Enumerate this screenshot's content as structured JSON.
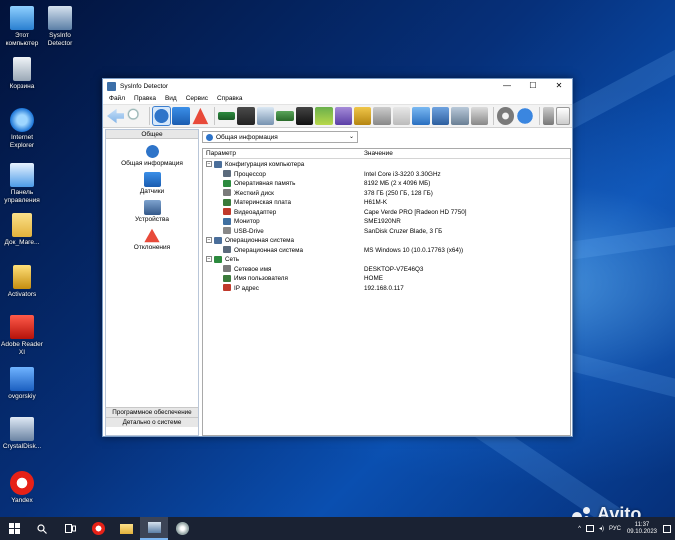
{
  "desktop": {
    "icons": [
      {
        "label": "Этот компьютер"
      },
      {
        "label": "SysInfo Detector"
      },
      {
        "label": "Корзина"
      },
      {
        "label": "Internet Explorer"
      },
      {
        "label": "Панель управления"
      },
      {
        "label": "Док_Маге..."
      },
      {
        "label": "Activators"
      },
      {
        "label": "Adobe Reader XI"
      },
      {
        "label": "ovgorskiy"
      },
      {
        "label": "CrystalDisk..."
      },
      {
        "label": "Yandex"
      }
    ]
  },
  "window": {
    "title": "SysInfo Detector",
    "minimize": "—",
    "maximize": "☐",
    "close": "✕"
  },
  "menu": [
    "Файл",
    "Правка",
    "Вид",
    "Сервис",
    "Справка"
  ],
  "toolbar": {
    "icons": [
      "back-arrow-icon",
      "search-icon",
      "info-icon",
      "sensors-icon",
      "warning-icon",
      "memory-icon",
      "cpu-icon",
      "display-icon",
      "motherboard-icon",
      "card-icon",
      "plug-icon",
      "tools-icon",
      "lock-icon",
      "gpu-icon",
      "camera-icon",
      "media-icon",
      "network-icon",
      "print-icon",
      "drive-icon",
      "gear-icon",
      "help-icon",
      "phone-icon",
      "file-icon"
    ]
  },
  "leftpane": {
    "header": "Общее",
    "items": [
      {
        "label": "Общая информация",
        "icon": "info-icon"
      },
      {
        "label": "Датчики",
        "icon": "sensors-icon"
      },
      {
        "label": "Устройства",
        "icon": "devices-icon"
      },
      {
        "label": "Отклонения",
        "icon": "warning-icon"
      }
    ],
    "bottom1": "Программное обеспечение",
    "bottom2": "Детально о системе"
  },
  "rightpane": {
    "combo_value": "Общая информация",
    "columns": {
      "param": "Параметр",
      "value": "Значение"
    },
    "rows": [
      {
        "kind": "group",
        "label": "Конфигурация компьютера",
        "value": ""
      },
      {
        "kind": "item",
        "label": "Процессор",
        "value": "Intel Core i3-3220 3.30GHz"
      },
      {
        "kind": "item",
        "label": "Оперативная память",
        "value": "8192 МБ (2 x 4096 МБ)"
      },
      {
        "kind": "item",
        "label": "Жесткий диск",
        "value": "378  ГБ (250 ГБ, 128 ГБ)"
      },
      {
        "kind": "item",
        "label": "Материнская плата",
        "value": "H61M-K"
      },
      {
        "kind": "item",
        "label": "Видеоадаптер",
        "value": "Cape Verde PRO [Radeon HD 7750]"
      },
      {
        "kind": "item",
        "label": "Монитор",
        "value": "SME1920NR"
      },
      {
        "kind": "item",
        "label": "USB-Drive",
        "value": "SanDisk Cruzer Blade, 3 ГБ"
      },
      {
        "kind": "group",
        "label": "Операционная система",
        "value": ""
      },
      {
        "kind": "item",
        "label": "Операционная система",
        "value": "MS Windows 10 (10.0.17763 (x64))"
      },
      {
        "kind": "group",
        "label": "Сеть",
        "value": ""
      },
      {
        "kind": "item",
        "label": "Сетевое имя",
        "value": "DESKTOP-V7E46Q3"
      },
      {
        "kind": "item",
        "label": "Имя пользователя",
        "value": "HOME"
      },
      {
        "kind": "item",
        "label": "IP адрес",
        "value": "192.168.0.117"
      }
    ]
  },
  "taskbar": {
    "lang": "РУС",
    "time": "11:37",
    "date": "09.10.2023"
  },
  "watermark": "Avito",
  "colors": {
    "accent": "#2e74c9",
    "taskbar": "#1a2233",
    "selected": "#d6e8fb"
  }
}
